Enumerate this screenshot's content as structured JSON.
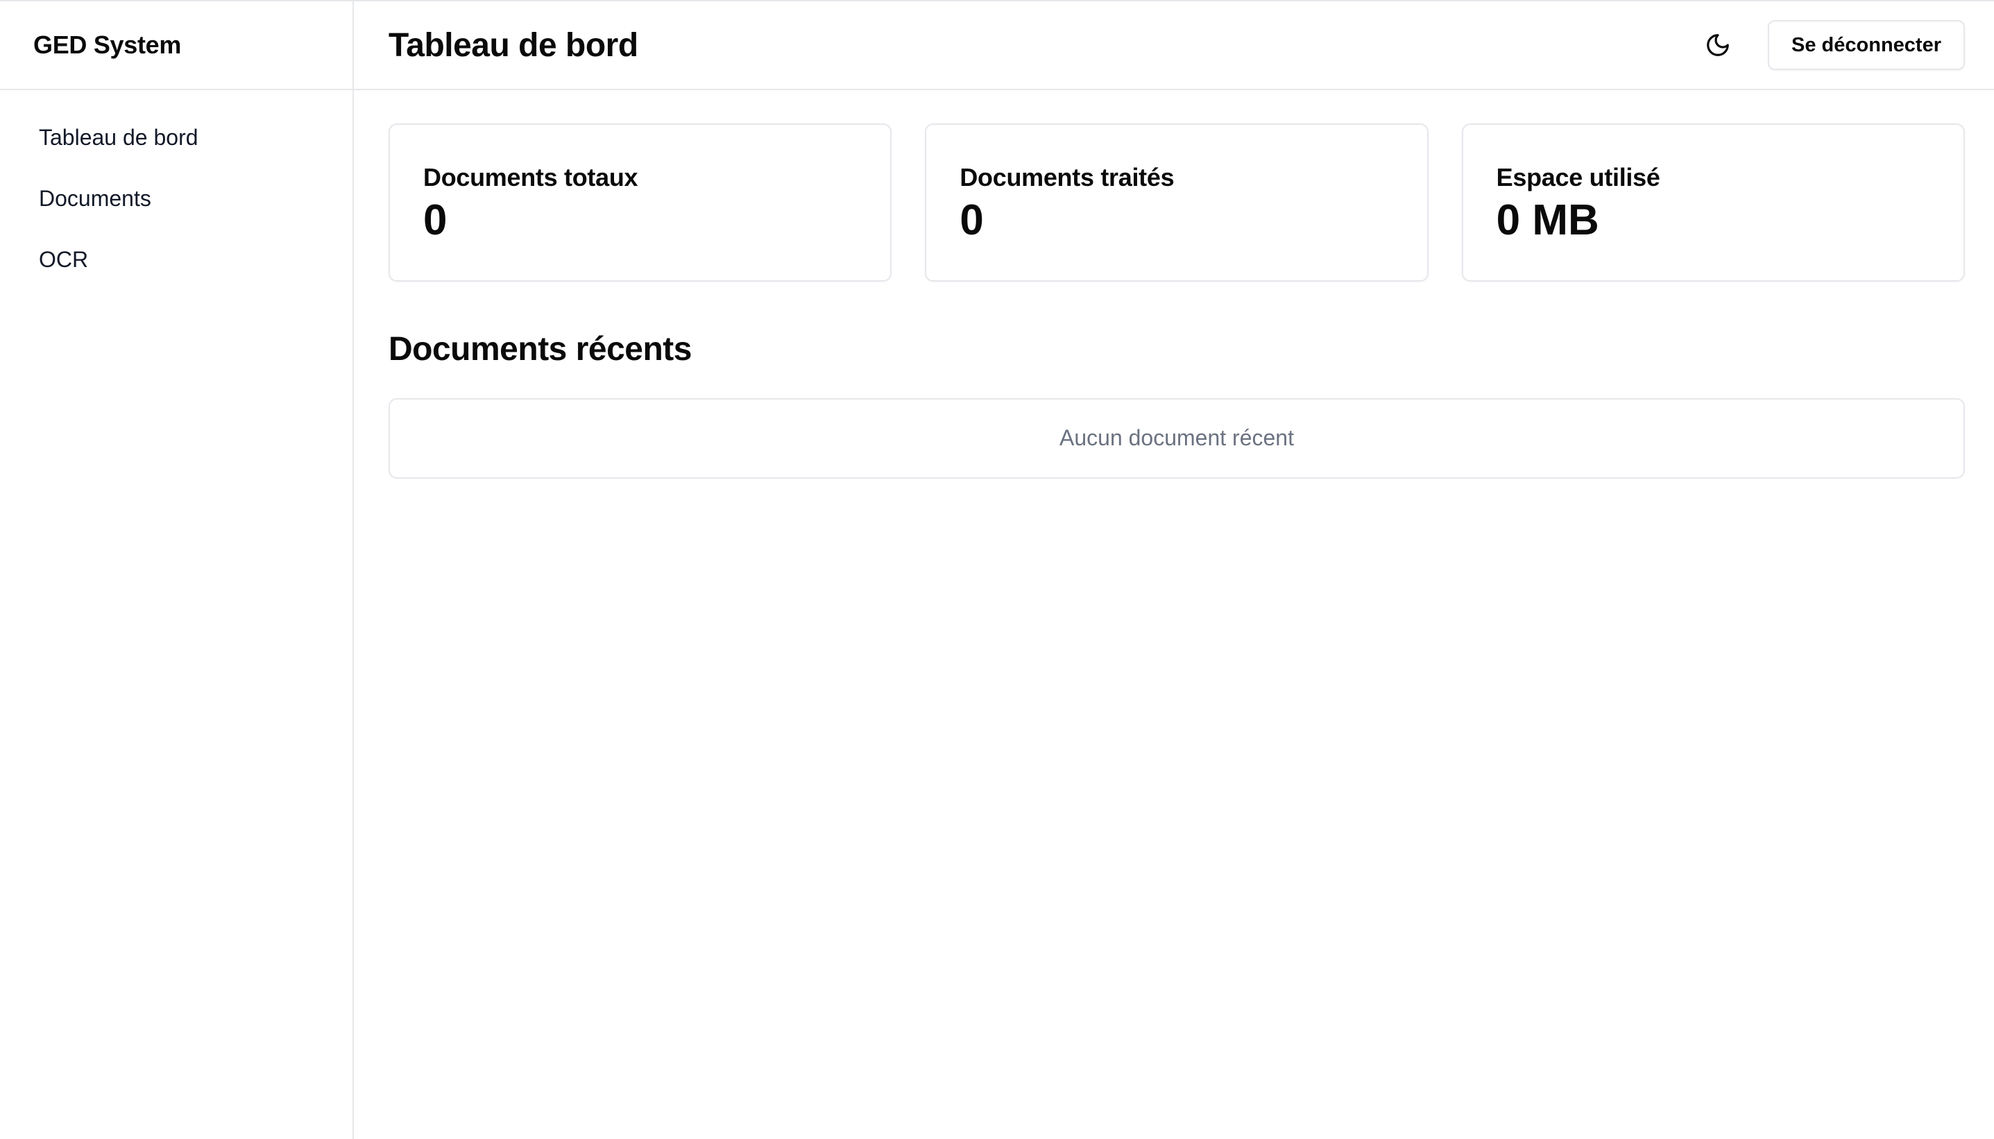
{
  "sidebar": {
    "app_title": "GED System",
    "items": [
      {
        "label": "Tableau de bord"
      },
      {
        "label": "Documents"
      },
      {
        "label": "OCR"
      }
    ]
  },
  "header": {
    "title": "Tableau de bord",
    "theme_icon": "moon-icon",
    "logout_label": "Se déconnecter"
  },
  "stats": [
    {
      "label": "Documents totaux",
      "value": "0"
    },
    {
      "label": "Documents traités",
      "value": "0"
    },
    {
      "label": "Espace utilisé",
      "value": "0 MB"
    }
  ],
  "recent": {
    "title": "Documents récents",
    "empty_message": "Aucun document récent"
  },
  "colors": {
    "border": "#e5e7eb",
    "muted_text": "#6b7280",
    "text": "#0a0a0a"
  }
}
